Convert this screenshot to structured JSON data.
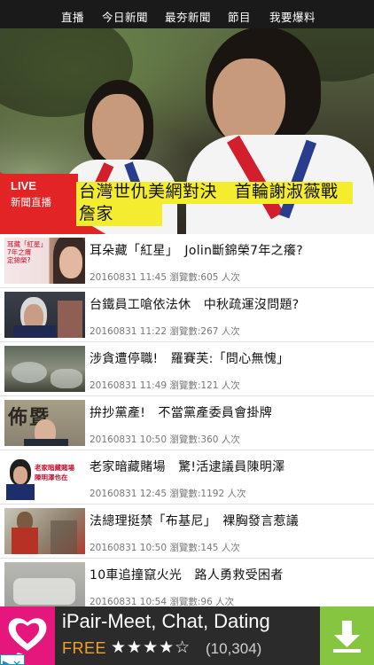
{
  "nav": {
    "tabs": [
      "直播",
      "今日新聞",
      "最夯新聞",
      "節目",
      "我要爆料"
    ]
  },
  "hero": {
    "live_label": "LIVE",
    "live_sub": "新聞直播",
    "headline": "台灣世仇美網對決　首輪謝淑薇戰詹家"
  },
  "news": [
    {
      "title": "耳朵藏「紅星」　Jolin斷錦榮7年之癢?",
      "meta": "20160831 11:45 瀏覽數:605 人次",
      "thumb_caption": "耳藏「紅星」\n7年之癢\n定錦榮?"
    },
    {
      "title": "台鐵員工嗆依法休　中秋疏運沒問題?",
      "meta": "20160831 11:22 瀏覽數:267 人次"
    },
    {
      "title": "涉貪遭停職!　羅賽芙:「問心無愧」",
      "meta": "20160831 11:49 瀏覽數:121 人次"
    },
    {
      "title": "拚抄黨產!　不當黨產委員會掛牌",
      "meta": "20160831 10:50 瀏覽數:360 人次",
      "thumb_caption": "佈暨"
    },
    {
      "title": "老家暗藏賭場　驚!活逮議員陳明澤",
      "meta": "20160831 12:45 瀏覽數:1192 人次",
      "thumb_caption": "老家暗藏賭場\n陳明澤也在"
    },
    {
      "title": "法總理挺禁「布基尼」　裸胸發言惹議",
      "meta": "20160831 10:50 瀏覽數:145 人次"
    },
    {
      "title": "10車追撞竄火光　路人勇救受困者",
      "meta": "20160831 10:54 瀏覽數:96 人次"
    }
  ],
  "ad": {
    "title": "iPair-Meet, Chat, Dating",
    "free": "FREE",
    "stars": "★★★★☆",
    "count": "(10,304)",
    "colors": {
      "icon_bg": "#e5177c",
      "download_bg": "#86c540",
      "free": "#f2a12b"
    },
    "icons": {
      "app": "heart-chat-icon",
      "download": "download-icon",
      "adchoices": "adchoices-icon"
    }
  },
  "colors": {
    "live_red": "#e32424",
    "headline_yellow": "#f4ec2e",
    "nav_bg": "#1a1a1a"
  }
}
